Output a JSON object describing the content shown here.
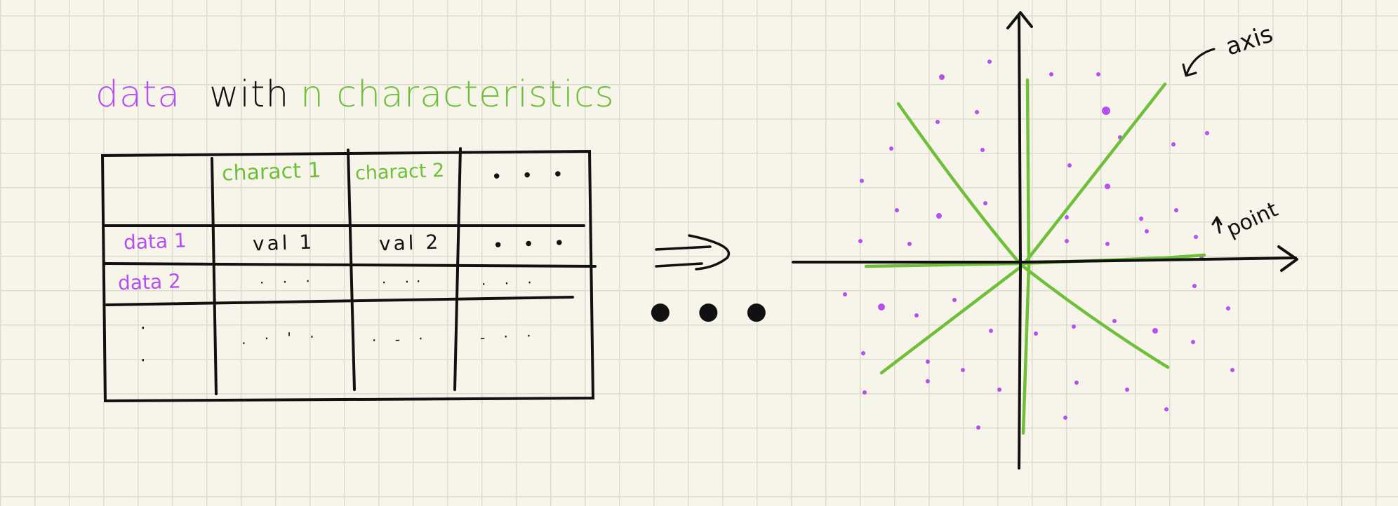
{
  "title": {
    "word_data": "data",
    "word_with": "with",
    "word_rest": "n characteristics"
  },
  "table": {
    "headers": [
      "charact 1",
      "charact 2",
      "• • •"
    ],
    "rows": [
      {
        "label": "data 1",
        "cells": [
          "val 1",
          "val 2",
          "• • •"
        ]
      },
      {
        "label": "data 2",
        "cells": [
          "· · ·",
          "· ··",
          "· ·  ·"
        ]
      },
      {
        "label": "·",
        "cells": [
          ". · ' ·",
          "· - ·",
          "- · ·"
        ]
      }
    ]
  },
  "transition": {
    "ellipsis": "● ● ●"
  },
  "plot": {
    "axis_label": "axis",
    "point_label": "point",
    "axis_color": "#6fbf3a",
    "point_color": "#b44ff0"
  },
  "colors": {
    "purple": "#b44ff0",
    "green": "#6fbf3a",
    "ink": "#111111",
    "paper": "#f7f5e9"
  }
}
